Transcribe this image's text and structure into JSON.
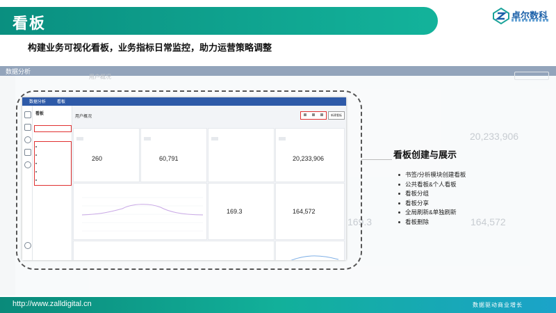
{
  "header": {
    "title": "看板"
  },
  "logo": {
    "text": "卓尔数科"
  },
  "subtitle": "构建业务可视化看板，业务指标日常监控，助力运营策略调整",
  "background_app": {
    "top_title": "数据分析",
    "panel_title": "用户概况",
    "numbers": [
      "20,233,906",
      "164,572",
      "169.3"
    ]
  },
  "screenshot": {
    "app_title": "数据分析",
    "tab": "看板",
    "nav_title": "看板",
    "main_title": "用户概况",
    "main_sub": "",
    "toolbar_button": "新建看板",
    "cards": [
      {
        "title": "",
        "value": "260"
      },
      {
        "title": "",
        "value": "60,791"
      },
      {
        "title": "",
        "value": ""
      },
      {
        "title": "",
        "value": "20,233,906"
      },
      {
        "title": "",
        "value": ""
      },
      {
        "title": "",
        "value": "169.3"
      },
      {
        "title": "",
        "value": "164,572"
      }
    ]
  },
  "features": {
    "title": "看板创建与展示",
    "items": [
      "书签/分析模块创建看板",
      "公共看板&个人看板",
      "看板分组",
      "看板分享",
      "全局刷新&单独刷新",
      "看板删除"
    ]
  },
  "footer": {
    "url": "http://www.zalldigital.cn",
    "slogan": "数据驱动商业增长"
  },
  "colors": {
    "brand_teal": "#0a8f80",
    "accent_red": "#e03030",
    "app_blue": "#2e5aa8"
  }
}
